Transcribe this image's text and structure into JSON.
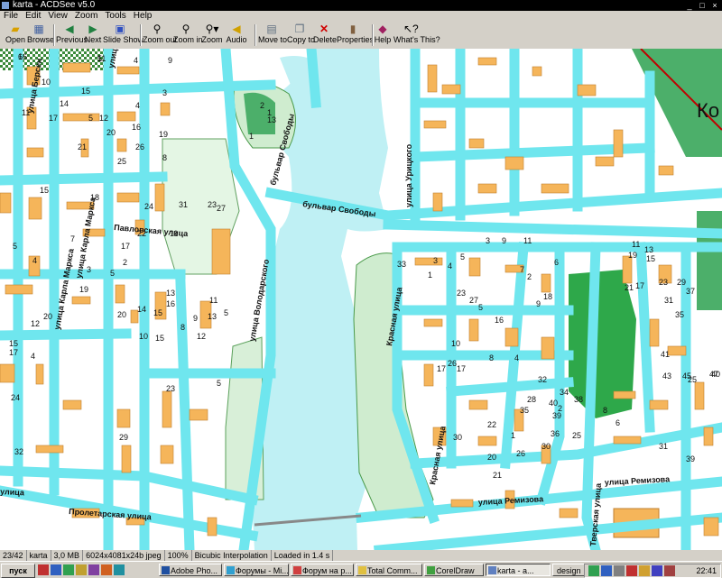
{
  "window": {
    "title": "karta - ACDSee v5.0",
    "buttons": [
      "_",
      "□",
      "×"
    ]
  },
  "menu": [
    "File",
    "Edit",
    "View",
    "Zoom",
    "Tools",
    "Help"
  ],
  "toolbar": {
    "open": "Open",
    "browse": "Browse",
    "previous": "Previous",
    "next": "Next",
    "slideshow": "Slide Show",
    "zoom_out": "Zoom out",
    "zoom_in": "Zoom in",
    "zoom": "Zoom",
    "audio": "Audio",
    "move_to": "Move to",
    "copy_to": "Copy to",
    "delete": "Delete",
    "properties": "Properties",
    "help": "Help",
    "whats_this": "What's This?"
  },
  "map": {
    "streets": {
      "bulvar_svobody_top": "бульвар Свободы",
      "bulvar_svobody": "бульвар Свободы",
      "ul_urickogo": "улица Урицкого",
      "ul_pavlovskaya": "Павловская улица",
      "ul_karla_marksa_1": "улица Карла Маркса",
      "ul_karla_marksa_2": "улица Карла Маркса",
      "ul_volodarskogo": "улица Володарского",
      "ul_krasnaya_1": "Красная улица",
      "ul_krasnaya_2": "Красная улица",
      "ul_remizova_1": "улица Ремизова",
      "ul_remizova_2": "улица Ремизова",
      "ul_tverskaya": "Тверская улица",
      "ul_proletarskaya": "Пролетарская улица",
      "ul_left": "улица",
      "ul_bersen": "улица Берсен",
      "ul_top": "улиц",
      "ko": "Ко"
    },
    "house_numbers": [
      "6",
      "5",
      "4",
      "9",
      "10",
      "15",
      "14",
      "4",
      "3",
      "2",
      "1",
      "13",
      "11",
      "17",
      "5",
      "12",
      "16",
      "20",
      "19",
      "21",
      "26",
      "25",
      "8",
      "15",
      "18",
      "24",
      "31",
      "23",
      "27",
      "22",
      "11",
      "1",
      "17",
      "5",
      "7",
      "4",
      "2",
      "3",
      "5",
      "19",
      "13",
      "14",
      "15",
      "16",
      "9",
      "13",
      "11",
      "10",
      "8",
      "12",
      "5",
      "1",
      "3",
      "4",
      "5",
      "7",
      "2",
      "6",
      "11",
      "13",
      "15",
      "19",
      "21",
      "17",
      "23",
      "29",
      "31",
      "37",
      "35",
      "33",
      "5",
      "16",
      "9",
      "18",
      "23",
      "27",
      "25",
      "41",
      "43",
      "45",
      "47",
      "20",
      "15",
      "35",
      "40",
      "39",
      "3",
      "9",
      "11",
      "20",
      "15",
      "12",
      "4",
      "10",
      "17",
      "17",
      "8",
      "4",
      "17",
      "32",
      "29",
      "23",
      "5",
      "26",
      "30",
      "22",
      "1",
      "21",
      "20",
      "26",
      "30",
      "28",
      "32",
      "34",
      "36",
      "38",
      "25",
      "2",
      "8",
      "6",
      "31",
      "39",
      "40",
      "24",
      "16",
      "11"
    ]
  },
  "status": {
    "index": "23/42",
    "name": "karta",
    "filesize": "3,0 MB",
    "dims": "6024x4081x24b jpeg",
    "zoom": "100%",
    "interp": "Bicubic Interpolation",
    "loaded": "Loaded in 1.4 s"
  },
  "taskbar": {
    "start": "пуск",
    "tasks": [
      "Adobe Pho...",
      "Форумы - Mi...",
      "Форум на р...",
      "Total Comm...",
      "CorelDraw",
      "karta - a...",
      "design"
    ],
    "clock": "22:41"
  }
}
